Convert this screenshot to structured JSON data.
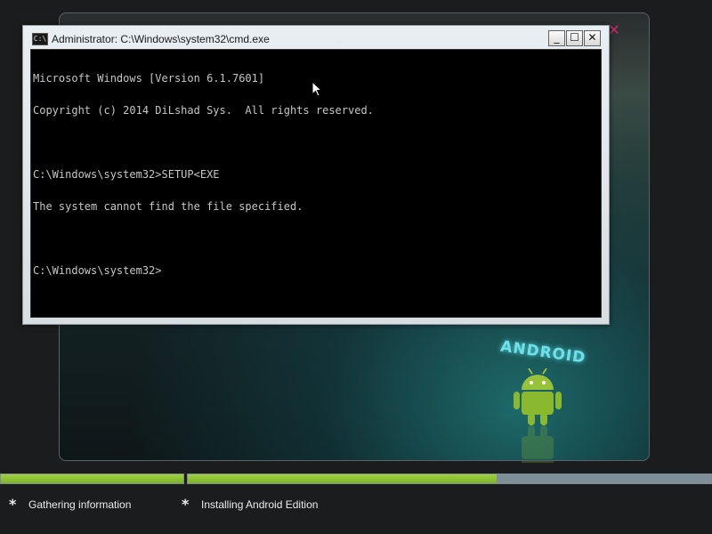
{
  "background": {
    "logo_text": "ANDROID",
    "close_glyph": "✕",
    "accent_close_color": "#cc2b6b",
    "robot_color": "#97c23a"
  },
  "cmd_window": {
    "title": "Administrator: C:\\Windows\\system32\\cmd.exe",
    "icon_text": "C:\\",
    "buttons": {
      "minimize": "_",
      "maximize": "☐",
      "close": "✕"
    },
    "lines": [
      "Microsoft Windows [Version 6.1.7601]",
      "Copyright (c) 2014 DiLshad Sys.  All rights reserved.",
      "",
      "C:\\Windows\\system32>SETUP<EXE",
      "The system cannot find the file specified.",
      "",
      "C:\\Windows\\system32>"
    ]
  },
  "progress": {
    "bar1_fraction": 1.0,
    "bar2_fraction": 0.59,
    "fill_color": "#8dc235"
  },
  "steps": [
    {
      "bullet": "*",
      "label": "Gathering information"
    },
    {
      "bullet": "*",
      "label": "Installing Android Edition"
    }
  ]
}
